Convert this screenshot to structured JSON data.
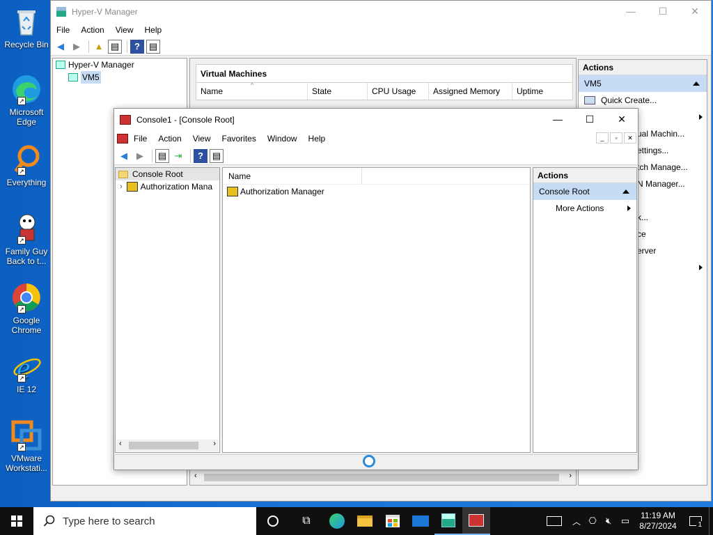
{
  "desktop_icons": [
    {
      "label": "Recycle Bin",
      "icon": "recycle-bin-icon"
    },
    {
      "label": "Microsoft Edge",
      "icon": "edge-icon"
    },
    {
      "label": "Everything",
      "icon": "search-icon"
    },
    {
      "label": "Family Guy Back to t...",
      "icon": "character-icon"
    },
    {
      "label": "Google Chrome",
      "icon": "chrome-icon"
    },
    {
      "label": "IE 12",
      "icon": "ie-icon"
    },
    {
      "label": "VMware Workstati...",
      "icon": "vmware-icon"
    }
  ],
  "hyperv": {
    "title": "Hyper-V Manager",
    "menu": [
      "File",
      "Action",
      "View",
      "Help"
    ],
    "tree_root": "Hyper-V Manager",
    "tree_child": "VM5",
    "vm_panel_title": "Virtual Machines",
    "columns": [
      "Name",
      "State",
      "CPU Usage",
      "Assigned Memory",
      "Uptime"
    ],
    "actions_title": "Actions",
    "actions_selected": "VM5",
    "actions_items": [
      "Quick Create...",
      "",
      "ual Machin...",
      "ettings...",
      "tch Manage...",
      "N Manager...",
      "",
      "k...",
      "ce",
      "erver"
    ]
  },
  "console": {
    "title": "Console1 - [Console Root]",
    "menu": [
      "File",
      "Action",
      "View",
      "Favorites",
      "Window",
      "Help"
    ],
    "tree_root": "Console Root",
    "tree_child": "Authorization Mana",
    "list_header": "Name",
    "list_items": [
      "Authorization Manager"
    ],
    "actions_title": "Actions",
    "actions_selected": "Console Root",
    "more_actions": "More Actions"
  },
  "taskbar": {
    "search_placeholder": "Type here to search",
    "time": "11:19 AM",
    "date": "8/27/2024",
    "notification_count": "1"
  },
  "colors": {
    "desktop": "#1a73d9",
    "selection": "#c6dbf4",
    "taskbar": "#101010"
  }
}
